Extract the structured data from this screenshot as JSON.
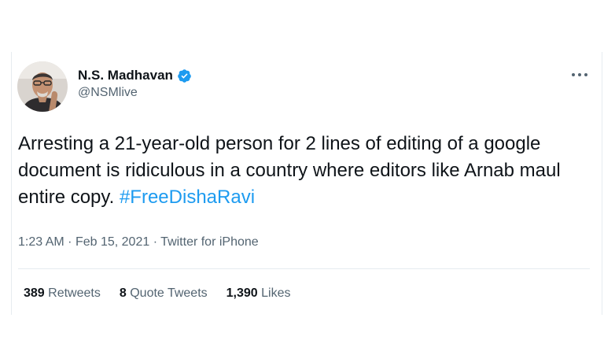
{
  "author": {
    "display_name": "N.S. Madhavan",
    "handle": "@NSMlive",
    "verified": true,
    "avatar_icon": "profile-photo"
  },
  "more_icon": "ellipsis-horizontal-icon",
  "tweet": {
    "text": "Arresting a 21-year-old person for 2 lines of editing of a google document is ridiculous in a country where editors like Arnab maul entire copy. ",
    "hashtag": "#FreeDishaRavi"
  },
  "meta": {
    "time": "1:23 AM",
    "separator": "·",
    "date": "Feb 15, 2021",
    "source": "Twitter for iPhone"
  },
  "stats": {
    "retweets_count": "389",
    "retweets_label": "Retweets",
    "quotes_count": "8",
    "quotes_label": "Quote Tweets",
    "likes_count": "1,390",
    "likes_label": "Likes"
  },
  "colors": {
    "text_primary": "#0f1419",
    "text_secondary": "#536471",
    "link_blue": "#1d9bf0",
    "verified_blue": "#1d9bf0",
    "border": "#e6ecf0"
  }
}
